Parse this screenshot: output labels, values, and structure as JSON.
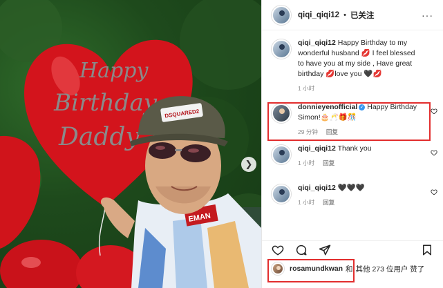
{
  "colors": {
    "accent_red": "#e22d2d",
    "verified_blue": "#3897f0",
    "text": "#262626",
    "muted": "#8e8e8e"
  },
  "photo": {
    "balloon_text_1": "Happy",
    "balloon_text_2": "Birthday",
    "balloon_text_3": "Daddy",
    "cap_badge": "DSQUARED2",
    "shirt_text": "EMAN"
  },
  "header": {
    "username": "qiqi_qiqi12",
    "dot": "•",
    "follow_status": "已关注",
    "more": "···"
  },
  "comments": [
    {
      "username": "qiqi_qiqi12",
      "text": " Happy Birthday to my wonderful husband 💋 I feel blessed to have you at my side , Have great birthday 💋love you 🖤💋",
      "time": "1 小时"
    },
    {
      "username": "donnieyenofficial",
      "verified": "✓",
      "text": " Happy Birthday Simon!🎂🥂🎁🎊",
      "time": "29 分钟",
      "reply": "回复"
    },
    {
      "username": "qiqi_qiqi12",
      "text": " Thank you",
      "time": "1 小时",
      "reply": "回复"
    },
    {
      "username": "qiqi_qiqi12",
      "text": " 🖤🖤🖤",
      "time": "1 小时",
      "reply": "回复"
    }
  ],
  "likes": {
    "username": "rosamundkwan",
    "and": "和",
    "others": "其他 273 位用户 赞了"
  },
  "icons": [
    "heart-icon",
    "comment-icon",
    "share-icon",
    "bookmark-icon",
    "chevron-right-icon",
    "verified-icon"
  ]
}
